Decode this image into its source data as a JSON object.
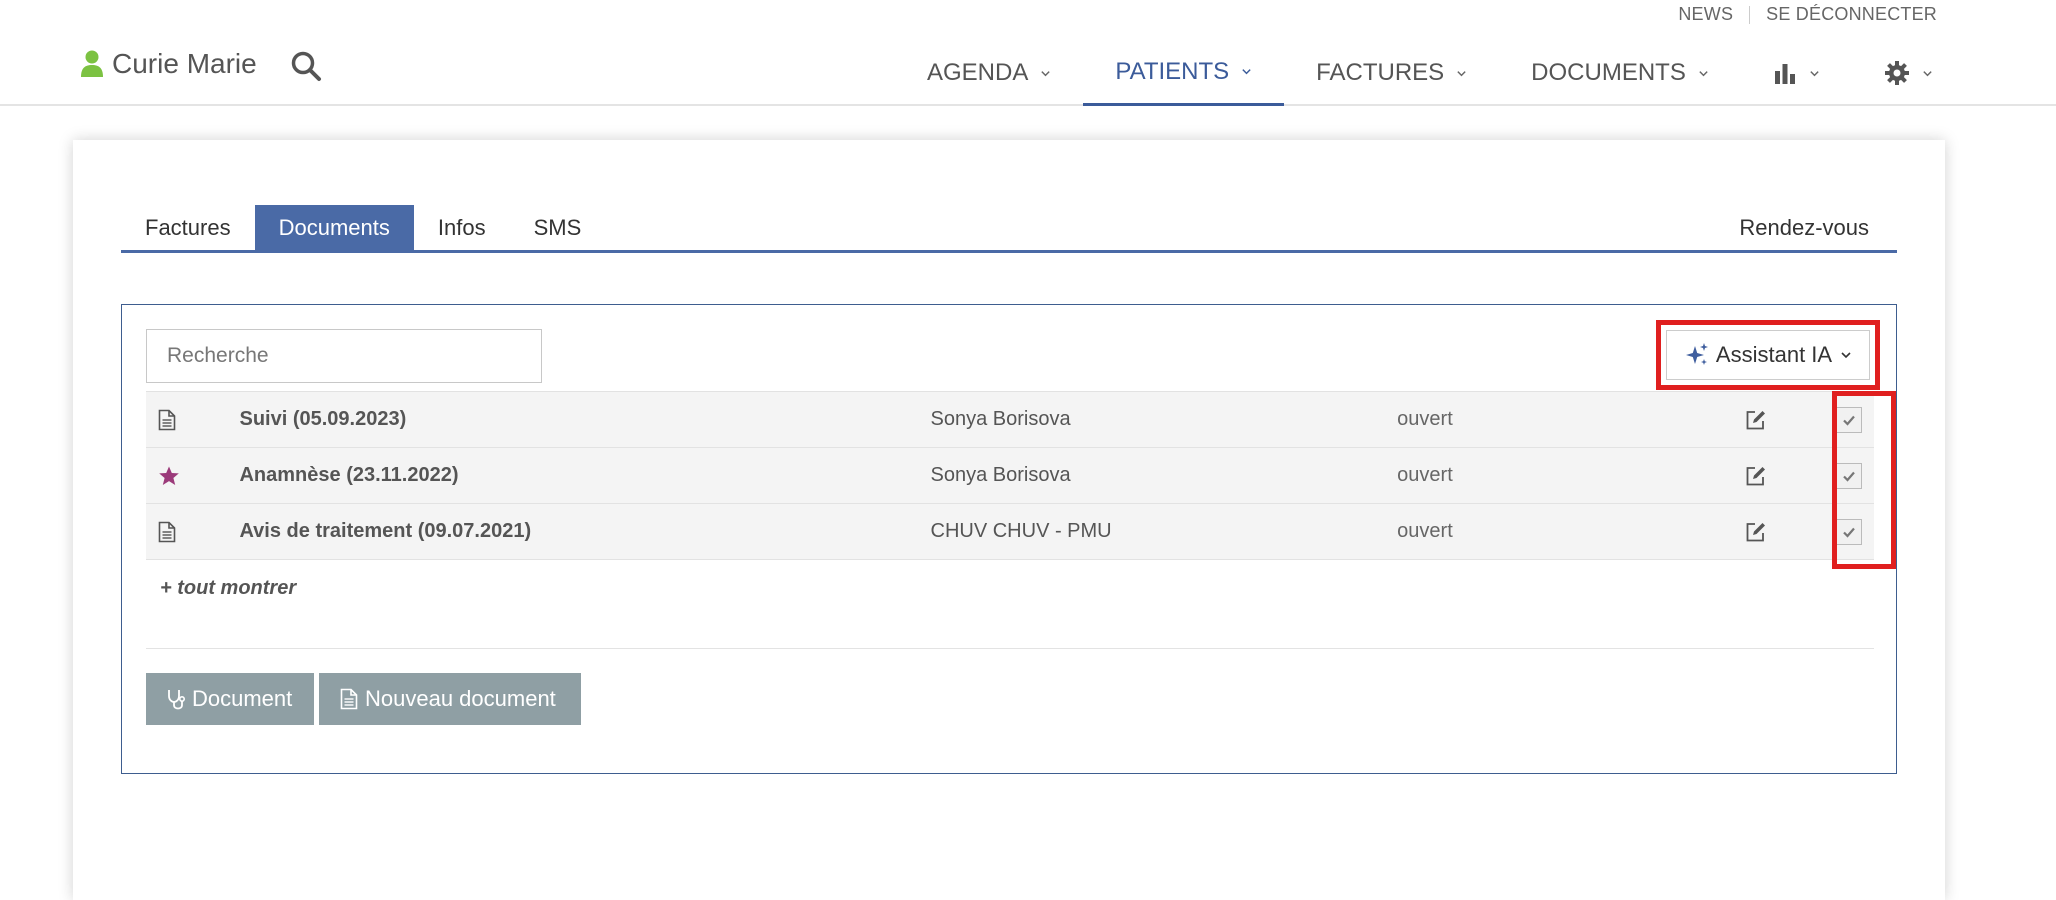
{
  "toplinks": {
    "news": "NEWS",
    "logout": "SE DÉCONNECTER"
  },
  "header": {
    "user_name": "Curie Marie",
    "nav": [
      {
        "label": "AGENDA",
        "active": false
      },
      {
        "label": "PATIENTS",
        "active": true
      },
      {
        "label": "FACTURES",
        "active": false
      },
      {
        "label": "DOCUMENTS",
        "active": false
      }
    ],
    "icons": {
      "stats": "bar-chart-icon",
      "settings": "gear-icon"
    }
  },
  "tabs": {
    "factures": "Factures",
    "documents": "Documents",
    "infos": "Infos",
    "sms": "SMS",
    "rendezvous": "Rendez-vous",
    "active": "Documents"
  },
  "panel": {
    "search_placeholder": "Recherche",
    "ai_button": "Assistant IA",
    "rows": [
      {
        "icon": "document-icon",
        "title": "Suivi (05.09.2023)",
        "author": "Sonya Borisova",
        "status": "ouvert"
      },
      {
        "icon": "star-icon",
        "title": "Anamnèse (23.11.2022)",
        "author": "Sonya Borisova",
        "status": "ouvert"
      },
      {
        "icon": "document-icon",
        "title": "Avis de traitement (09.07.2021)",
        "author": "CHUV CHUV - PMU",
        "status": "ouvert"
      }
    ],
    "show_all": "+ tout montrer",
    "btn_document": "Document",
    "btn_new_document": "Nouveau document"
  },
  "colors": {
    "accent": "#4a6aa6",
    "highlight": "#e01f1f",
    "user_icon": "#7cc242",
    "star": "#9b3a7a",
    "button": "#8f9fa4"
  }
}
